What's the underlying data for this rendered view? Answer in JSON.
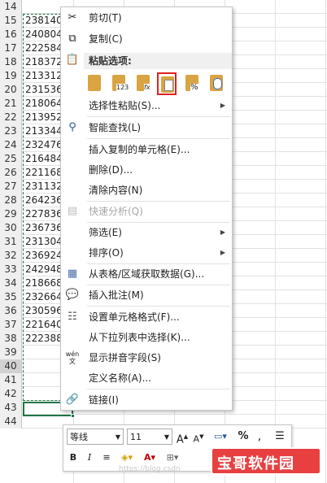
{
  "sheet": {
    "rows": [
      {
        "num": "14",
        "value": ""
      },
      {
        "num": "15",
        "value": "238140"
      },
      {
        "num": "16",
        "value": "240804"
      },
      {
        "num": "17",
        "value": "222584"
      },
      {
        "num": "18",
        "value": "218372"
      },
      {
        "num": "19",
        "value": "213312"
      },
      {
        "num": "20",
        "value": "231536"
      },
      {
        "num": "21",
        "value": "218064"
      },
      {
        "num": "22",
        "value": "213952"
      },
      {
        "num": "23",
        "value": "213344"
      },
      {
        "num": "24",
        "value": "232476"
      },
      {
        "num": "25",
        "value": "216484"
      },
      {
        "num": "26",
        "value": "221168"
      },
      {
        "num": "27",
        "value": "231132"
      },
      {
        "num": "28",
        "value": "264236"
      },
      {
        "num": "29",
        "value": "227836"
      },
      {
        "num": "30",
        "value": "236736"
      },
      {
        "num": "31",
        "value": "231304"
      },
      {
        "num": "32",
        "value": "236924"
      },
      {
        "num": "33",
        "value": "242948"
      },
      {
        "num": "34",
        "value": "218668"
      },
      {
        "num": "35",
        "value": "232664"
      },
      {
        "num": "36",
        "value": "230596"
      },
      {
        "num": "37",
        "value": "221640"
      },
      {
        "num": "38",
        "value": "222388"
      },
      {
        "num": "39",
        "value": ""
      },
      {
        "num": "40",
        "value": ""
      },
      {
        "num": "41",
        "value": ""
      },
      {
        "num": "42",
        "value": ""
      },
      {
        "num": "43",
        "value": ""
      },
      {
        "num": "44",
        "value": ""
      }
    ]
  },
  "menu": {
    "cut": "剪切(T)",
    "copy": "复制(C)",
    "paste_options": "粘贴选项:",
    "paste_icons": {
      "values": "123",
      "formula": "fx",
      "percent": "%"
    },
    "paste_special": "选择性粘贴(S)...",
    "smart_lookup": "智能查找(L)",
    "insert_copied": "插入复制的单元格(E)...",
    "delete": "删除(D)...",
    "clear": "清除内容(N)",
    "quick_analysis": "快速分析(Q)",
    "filter": "筛选(E)",
    "sort": "排序(O)",
    "get_data": "从表格/区域获取数据(G)...",
    "insert_comment": "插入批注(M)",
    "format_cells": "设置单元格格式(F)...",
    "pick_from_list": "从下拉列表中选择(K)...",
    "show_pinyin": "显示拼音字段(S)",
    "define_name": "定义名称(A)...",
    "link": "链接(I)",
    "pinyin_icon_text": "wén"
  },
  "mini_toolbar": {
    "font": "等线",
    "size": "11",
    "bold": "B",
    "italic": "I"
  },
  "watermark": {
    "text": "宝哥软件园",
    "faint": "https://blog.csdn"
  },
  "colors": {
    "accent": "#217346",
    "highlight_border": "#e02020",
    "watermark": "#e84040"
  }
}
